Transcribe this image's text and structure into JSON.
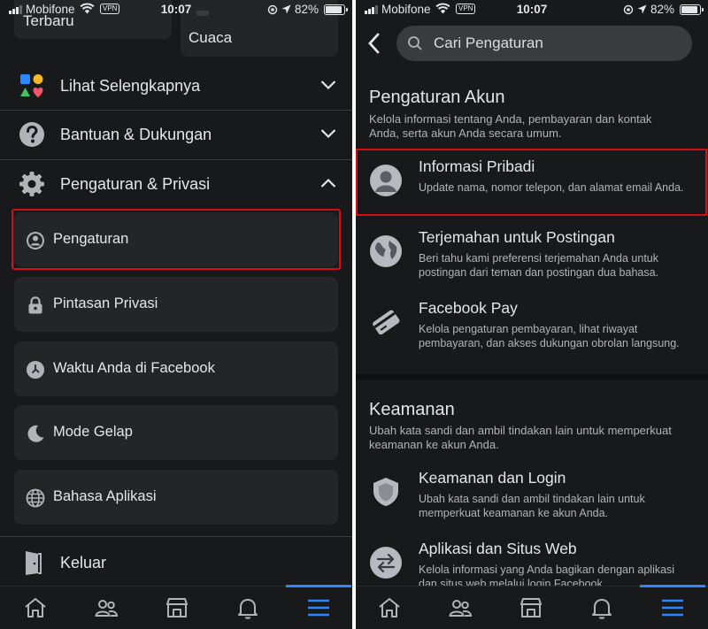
{
  "status_left": {
    "carrier": "Mobifone",
    "vpn": "VPN",
    "time": "10:07",
    "battery": "82%"
  },
  "status_right": {
    "carrier": "Mobifone",
    "vpn": "VPN",
    "time": "10:07",
    "battery": "82%"
  },
  "left": {
    "top_cards": [
      "Terbaru",
      "Cuaca"
    ],
    "rows": {
      "see_more": "Lihat Selengkapnya",
      "help": "Bantuan & Dukungan",
      "settings_privacy": "Pengaturan & Privasi",
      "logout": "Keluar"
    },
    "items": [
      "Pengaturan",
      "Pintasan Privasi",
      "Waktu Anda di Facebook",
      "Mode Gelap",
      "Bahasa Aplikasi"
    ]
  },
  "right": {
    "search": {
      "placeholder": "Cari Pengaturan"
    },
    "account": {
      "title": "Pengaturan Akun",
      "desc": "Kelola informasi tentang Anda, pembayaran dan kontak Anda, serta akun Anda secara umum.",
      "entries": [
        {
          "title": "Informasi Pribadi",
          "desc": "Update nama, nomor telepon, dan alamat email Anda."
        },
        {
          "title": "Terjemahan untuk Postingan",
          "desc": "Beri tahu kami preferensi terjemahan Anda untuk postingan dari teman dan postingan dua bahasa."
        },
        {
          "title": "Facebook Pay",
          "desc": "Kelola pengaturan pembayaran, lihat riwayat pembayaran, dan akses dukungan obrolan langsung."
        }
      ]
    },
    "security": {
      "title": "Keamanan",
      "desc": "Ubah kata sandi dan ambil tindakan lain untuk memperkuat keamanan ke akun Anda.",
      "entries": [
        {
          "title": "Keamanan dan Login",
          "desc": "Ubah kata sandi dan ambil tindakan lain untuk memperkuat keamanan ke akun Anda."
        },
        {
          "title": "Aplikasi dan Situs Web",
          "desc": "Kelola informasi yang Anda bagikan dengan aplikasi dan situs web melalui login Facebook"
        }
      ]
    }
  },
  "nav_icons": [
    "home-icon",
    "friends-icon",
    "marketplace-icon",
    "notifications-icon",
    "menu-icon"
  ],
  "colors": {
    "background": "#18191a",
    "card": "#242526",
    "highlight": "#d10f14",
    "accent": "#2d88ff"
  }
}
